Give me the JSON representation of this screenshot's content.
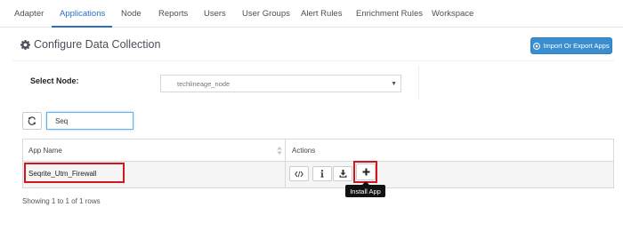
{
  "tabs": [
    {
      "label": "Adapter"
    },
    {
      "label": "Applications",
      "active": true
    },
    {
      "label": "Node"
    },
    {
      "label": "Reports"
    },
    {
      "label": "Users"
    },
    {
      "label": "User Groups"
    },
    {
      "label": "Alert Rules"
    },
    {
      "label": "Enrichment Rules"
    },
    {
      "label": "Workspace"
    }
  ],
  "page": {
    "title": "Configure Data Collection",
    "title_icon": "gear-icon",
    "import_export_label": "Import Or Export Apps",
    "import_export_icon": "info-circle-icon"
  },
  "node_select": {
    "label": "Select Node:",
    "value": "techlineage_node"
  },
  "search": {
    "value": "Seq",
    "refresh_icon": "refresh-icon"
  },
  "table": {
    "columns": [
      "App Name",
      "Actions"
    ],
    "rows": [
      {
        "app_name": "Seqrite_Utm_Firewall",
        "actions": [
          "code-icon",
          "info-icon",
          "download-icon",
          "plus-icon"
        ]
      }
    ]
  },
  "tooltip": "Install App",
  "footer": "Showing 1 to 1 of 1 rows",
  "colors": {
    "accent": "#2a6fc2",
    "button_blue": "#3a8ed0",
    "highlight_red": "#d3161d",
    "tooltip_bg": "#111111"
  }
}
